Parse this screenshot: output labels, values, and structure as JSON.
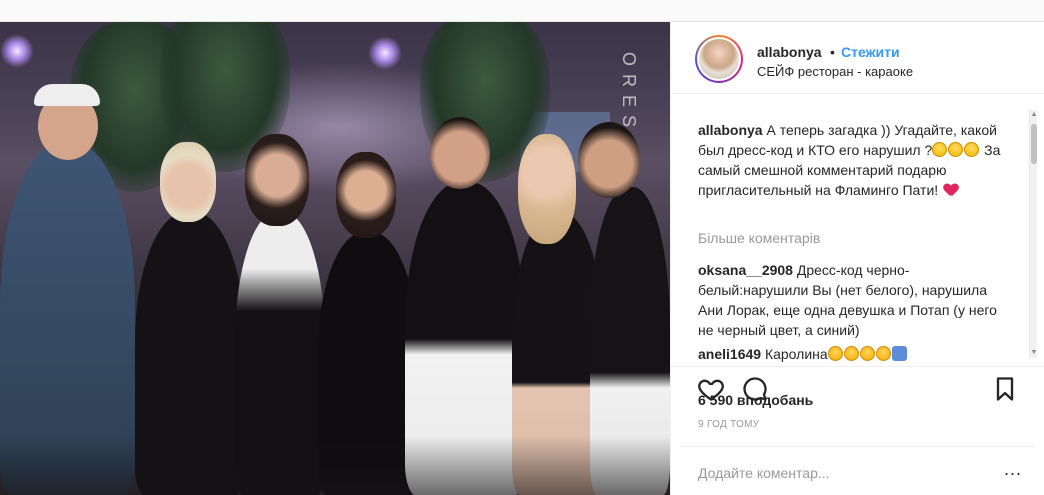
{
  "post": {
    "photo": {
      "brand_mark": "ORES"
    },
    "header": {
      "username": "allabonya",
      "separator": "•",
      "follow_label": "Стежити",
      "location": "СЕЙФ ресторан - караоке"
    },
    "caption": {
      "username": "allabonya",
      "text_part1": "А теперь загадка )) Угадайте, какой был дресс-код и КТО его нарушил ?",
      "text_part2": " За самый смешной комментарий подарю пригласительный на Фламинго Пати!",
      "emojis_after_part1": [
        "laughing-face",
        "laughing-face",
        "laughing-face"
      ],
      "emoji_end": "red-heart"
    },
    "more_comments_label": "Більше коментарів",
    "comments": [
      {
        "username": "oksana__2908",
        "text": "Дресс-код черно-белый:нарушили Вы (нет белого), нарушила Ани Лорак, еще одна девушка и Потап (у него не черный цвет, а синий)"
      },
      {
        "username": "aneli1649",
        "text": "Каролина",
        "emojis": [
          "kissing-face",
          "heart-eyes-face",
          "heart-eyes-face",
          "heart-eyes-face",
          "raising-hands"
        ]
      }
    ],
    "actions": {
      "like_icon": "heart-icon",
      "comment_icon": "speech-bubble-icon",
      "save_icon": "bookmark-icon"
    },
    "likes_text": "6 590 вподобань",
    "timestamp": "9 ГОД ТОМУ",
    "add_comment": {
      "placeholder": "Додайте коментар...",
      "options_label": "..."
    },
    "colors": {
      "link_blue": "#3897f0",
      "text": "#262626",
      "muted": "#999999",
      "heart_red": "#e0245e"
    }
  }
}
